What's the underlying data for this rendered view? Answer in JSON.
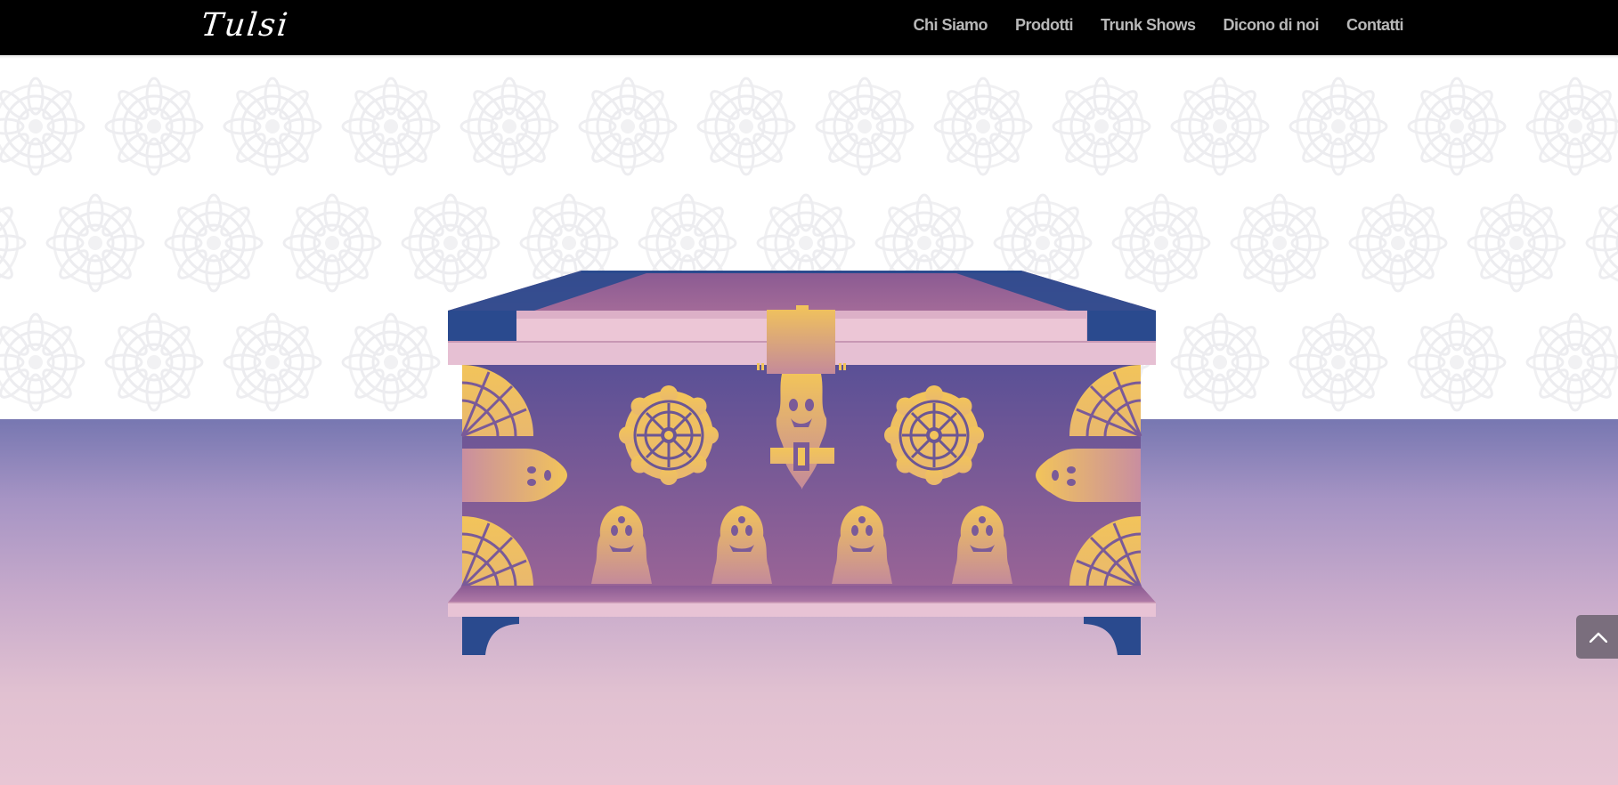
{
  "header": {
    "logo_text": "Tulsi",
    "nav": [
      {
        "label": "Chi Siamo"
      },
      {
        "label": "Prodotti"
      },
      {
        "label": "Trunk Shows"
      },
      {
        "label": "Dicono di noi"
      },
      {
        "label": "Contatti"
      }
    ]
  },
  "hero": {
    "illustration": "decorated-treasure-chest",
    "background_pattern": "mandala-pattern"
  },
  "back_to_top": {
    "icon": "chevron-up-icon"
  },
  "colors": {
    "header_bg": "#000000",
    "nav_text": "#b8b8b8",
    "chest_body": "#7a5a9c",
    "chest_lid": "#9b6a98",
    "chest_trim": "#e6c0d3",
    "chest_corner": "#2a4a8e",
    "chest_gold": "#f0c35a",
    "floor_top": "#7777b1",
    "floor_bottom": "#e8c6d4",
    "back_to_top_bg": "#7a6e7d"
  }
}
